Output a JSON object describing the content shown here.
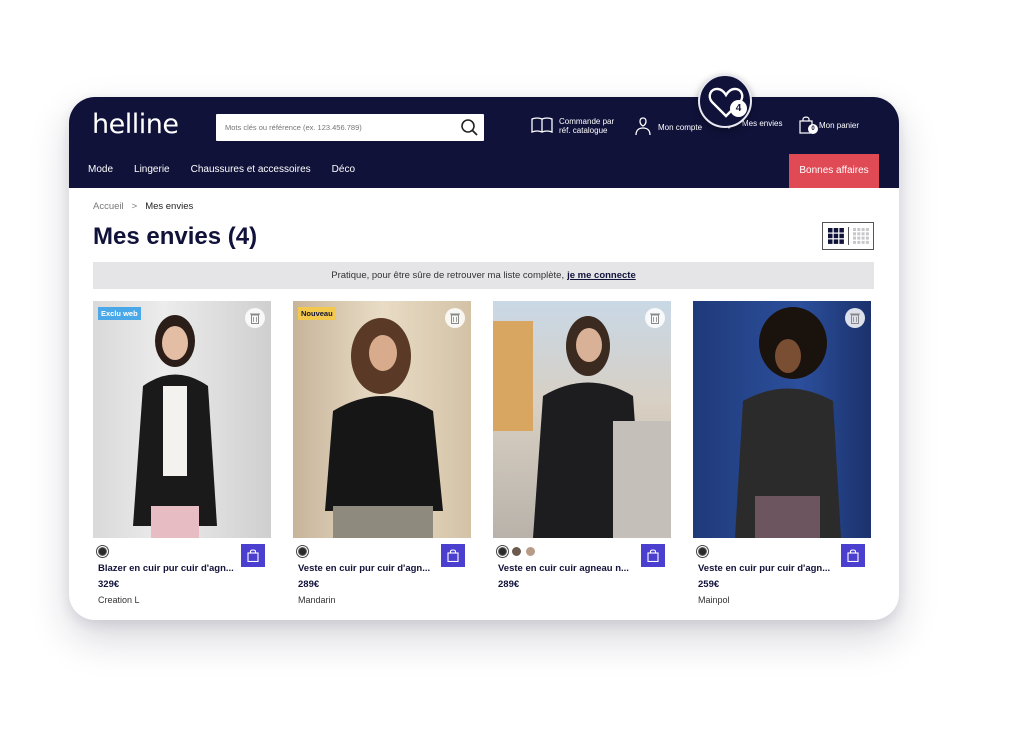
{
  "header": {
    "logo": "helline",
    "search_placeholder": "Mots clés ou référence (ex. 123.456.789)",
    "catalog_line1": "Commande par",
    "catalog_line2": "réf. catalogue",
    "account": "Mon compte",
    "wishlist": "Mes envies",
    "cart": "Mon panier",
    "cart_count": "0",
    "wishlist_count": "4"
  },
  "nav": {
    "items": [
      "Mode",
      "Lingerie",
      "Chaussures et accessoires",
      "Déco"
    ],
    "deals": "Bonnes affaires"
  },
  "breadcrumb": {
    "home": "Accueil",
    "separator": ">",
    "current": "Mes envies"
  },
  "page_title": "Mes envies (4)",
  "banner": {
    "text": "Pratique, pour être sûre de retrouver ma liste complète,",
    "link": "je me connecte"
  },
  "colors": {
    "navy": "#10123a",
    "accent_red": "#e04a55",
    "cart_button": "#4b3fd0",
    "tag_blue": "#4aa8e8",
    "tag_yellow": "#f2c94c"
  },
  "products": [
    {
      "tag": "Exclu web",
      "name": "Blazer en cuir pur cuir d'agn...",
      "price": "329€",
      "brand": "Creation L",
      "swatches": [
        "#2a2a2a"
      ]
    },
    {
      "tag": "Nouveau",
      "name": "Veste en cuir pur cuir d'agn...",
      "price": "289€",
      "brand": "Mandarin",
      "swatches": [
        "#2a2a2a"
      ]
    },
    {
      "tag": "",
      "name": "Veste en cuir cuir agneau n...",
      "price": "289€",
      "brand": "",
      "swatches": [
        "#2a2a2a",
        "#6b5a4e",
        "#b89a88"
      ]
    },
    {
      "tag": "",
      "name": "Veste en cuir pur cuir d'agn...",
      "price": "259€",
      "brand": "Mainpol",
      "swatches": [
        "#2a2a2a"
      ]
    }
  ]
}
